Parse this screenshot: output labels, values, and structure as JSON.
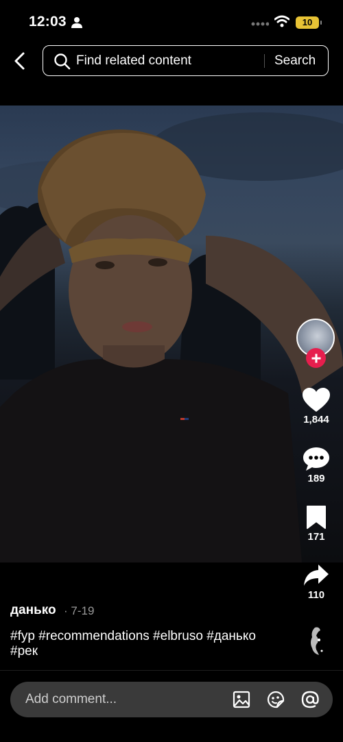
{
  "status_bar": {
    "time": "12:03",
    "battery": "10",
    "icons": [
      "person-icon",
      "signal-dots-icon",
      "wifi-icon"
    ]
  },
  "header": {
    "back_icon": "chevron-left-icon",
    "search_placeholder": "Find related content",
    "search_button": "Search"
  },
  "video": {
    "description": "video-frame"
  },
  "actions": {
    "like_count": "1,844",
    "comment_count": "189",
    "save_count": "171",
    "share_count": "110",
    "icons": [
      "heart-icon",
      "comment-bubble-icon",
      "bookmark-icon",
      "share-arrow-icon"
    ]
  },
  "post": {
    "username": "данько",
    "date": "· 7-19",
    "caption": "#fyp #recommendations #elbruso #данько #рек"
  },
  "comment_bar": {
    "placeholder": "Add comment...",
    "icons": [
      "image-icon",
      "emoji-sticker-icon",
      "mention-icon"
    ]
  },
  "colors": {
    "background": "#000000",
    "accent_red": "#e61e4d",
    "battery_yellow": "#e8c335",
    "comment_bar": "#3a3a3a"
  }
}
